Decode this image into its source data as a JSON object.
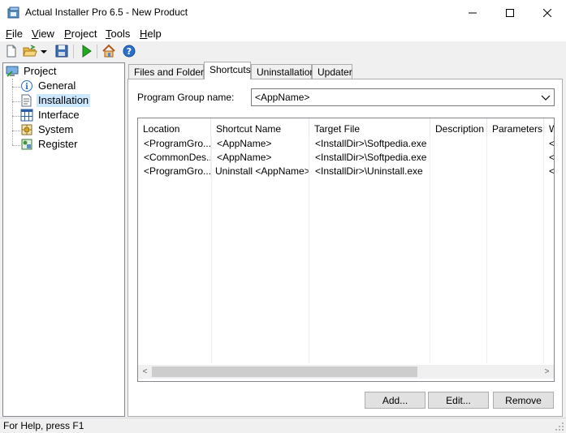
{
  "window": {
    "title": "Actual Installer Pro 6.5 - New Product",
    "minimize_icon": "minimize-icon",
    "maximize_icon": "maximize-icon",
    "close_icon": "close-icon"
  },
  "menu": {
    "items": [
      {
        "label": "File",
        "accel": "F",
        "rest": "ile"
      },
      {
        "label": "View",
        "accel": "V",
        "rest": "iew"
      },
      {
        "label": "Project",
        "accel": "P",
        "rest": "roject"
      },
      {
        "label": "Tools",
        "accel": "T",
        "rest": "ools"
      },
      {
        "label": "Help",
        "accel": "H",
        "rest": "elp"
      }
    ]
  },
  "toolbar": {
    "buttons": [
      "new-document-icon",
      "open-folder-icon",
      "dropdown-arrow-icon",
      "save-icon",
      "run-build-icon",
      "home-icon",
      "help-icon"
    ]
  },
  "tree": {
    "root": {
      "label": "Project",
      "icon": "computer-icon"
    },
    "children": [
      {
        "label": "General",
        "icon": "info-icon",
        "selected": false
      },
      {
        "label": "Installation",
        "icon": "installation-icon",
        "selected": true
      },
      {
        "label": "Interface",
        "icon": "interface-icon",
        "selected": false
      },
      {
        "label": "System",
        "icon": "system-icon",
        "selected": false
      },
      {
        "label": "Register",
        "icon": "register-icon",
        "selected": false
      }
    ]
  },
  "tabs": [
    {
      "label": "Files and Folders",
      "active": false
    },
    {
      "label": "Shortcuts",
      "active": true
    },
    {
      "label": "Uninstallation",
      "active": false
    },
    {
      "label": "Updater",
      "active": false
    }
  ],
  "program_group": {
    "label": "Program Group name:",
    "value": "<AppName>"
  },
  "shortcuts_table": {
    "columns": [
      "Location",
      "Shortcut Name",
      "Target File",
      "Description",
      "Parameters",
      "W"
    ],
    "rows": [
      [
        "<ProgramGro...",
        "<AppName>",
        "<InstallDir>\\Softpedia.exe",
        "",
        "",
        "<"
      ],
      [
        "<CommonDes...",
        "<AppName>",
        "<InstallDir>\\Softpedia.exe",
        "",
        "",
        "<"
      ],
      [
        "<ProgramGro...",
        "Uninstall <AppName>",
        "<InstallDir>\\Uninstall.exe",
        "",
        "",
        "<"
      ]
    ],
    "scroll_left": "<",
    "scroll_right": ">"
  },
  "buttons": {
    "add": "Add...",
    "edit": "Edit...",
    "remove": "Remove"
  },
  "status": {
    "text": "For Help, press F1"
  },
  "colors": {
    "selection": "#cce8ff",
    "window_bg": "#f0f0f0"
  }
}
